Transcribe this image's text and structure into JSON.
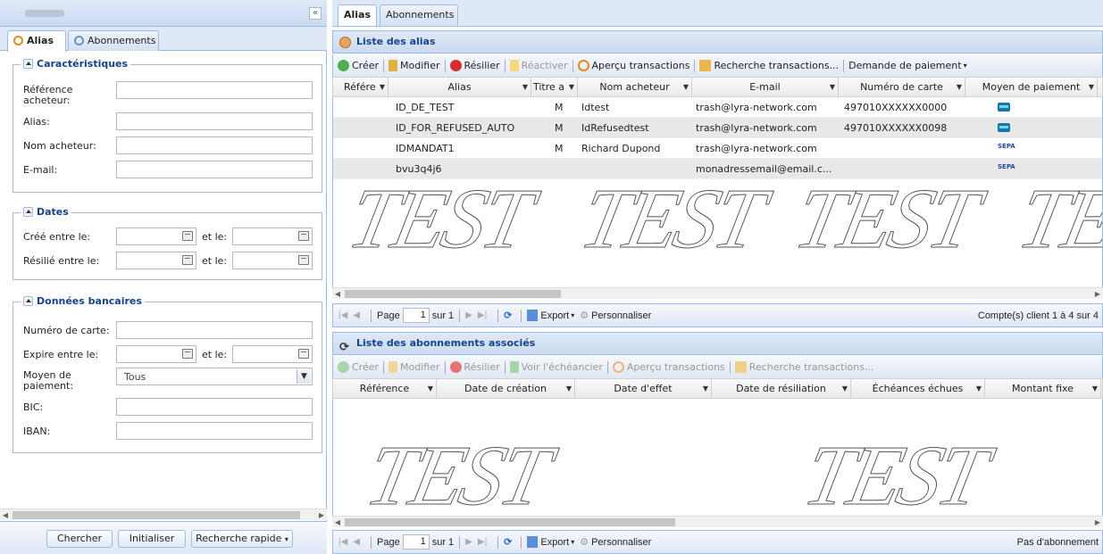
{
  "left_panel": {
    "collapse_glyph": "«",
    "tabs": [
      {
        "label": "Alias"
      },
      {
        "label": "Abonnements"
      }
    ],
    "sections": {
      "caracteristiques": {
        "title": "Caractéristiques",
        "fields": {
          "reference": {
            "label": "Référence acheteur:",
            "value": ""
          },
          "alias": {
            "label": "Alias:",
            "value": ""
          },
          "nom": {
            "label": "Nom acheteur:",
            "value": ""
          },
          "email": {
            "label": "E-mail:",
            "value": ""
          }
        }
      },
      "dates": {
        "title": "Dates",
        "cree": {
          "label": "Créé entre le:",
          "and_label": "et le:"
        },
        "resilie": {
          "label": "Résilié entre le:",
          "and_label": "et le:"
        }
      },
      "bancaires": {
        "title": "Données bancaires",
        "numero": {
          "label": "Numéro de carte:",
          "value": ""
        },
        "expire": {
          "label": "Expire entre le:",
          "and_label": "et le:"
        },
        "moyen": {
          "label": "Moyen de paiement:",
          "value": "Tous"
        },
        "bic": {
          "label": "BIC:",
          "value": ""
        },
        "iban": {
          "label": "IBAN:",
          "value": ""
        }
      }
    },
    "buttons": {
      "search": "Chercher",
      "reset": "Initialiser",
      "quick": "Recherche rapide"
    }
  },
  "right_panel": {
    "tabs": [
      {
        "label": "Alias"
      },
      {
        "label": "Abonnements"
      }
    ],
    "alias_list": {
      "title": "Liste des alias",
      "toolbar": [
        "Créer",
        "Modifier",
        "Résilier",
        "Réactiver",
        "Aperçu transactions",
        "Recherche transactions...",
        "Demande de paiement"
      ],
      "columns": [
        "Référe",
        "Alias",
        "Titre a",
        "Nom acheteur",
        "E-mail",
        "Numéro de carte",
        "Moyen de paiement"
      ],
      "rows": [
        {
          "ref": "",
          "alias": "ID_DE_TEST",
          "titre": "M",
          "nom": "Idtest",
          "email": "trash@lyra-network.com",
          "carte": "497010XXXXXX0000",
          "moyen": "CB"
        },
        {
          "ref": "",
          "alias": "ID_FOR_REFUSED_AUTO",
          "titre": "M",
          "nom": "IdRefusedtest",
          "email": "trash@lyra-network.com",
          "carte": "497010XXXXXX0098",
          "moyen": "CB"
        },
        {
          "ref": "",
          "alias": "IDMANDAT1",
          "titre": "M",
          "nom": "Richard Dupond",
          "email": "trash@lyra-network.com",
          "carte": "",
          "moyen": "SEPA"
        },
        {
          "ref": "",
          "alias": "bvu3q4j6",
          "titre": "",
          "nom": "",
          "email": "monadressemail@email.c...",
          "carte": "",
          "moyen": "SEPA"
        }
      ],
      "pager": {
        "page_label": "Page",
        "page": "1",
        "of": "sur 1",
        "export": "Export",
        "customize": "Personnaliser",
        "status": "Compte(s) client 1 à 4 sur 4"
      }
    },
    "subs_list": {
      "title": "Liste des abonnements associés",
      "toolbar": [
        "Créer",
        "Modifier",
        "Résilier",
        "Voir l'échéancier",
        "Aperçu transactions",
        "Recherche transactions..."
      ],
      "columns": [
        "Référence",
        "Date de création",
        "Date d'effet",
        "Date de résiliation",
        "Échéances échues",
        "Montant fixe"
      ],
      "pager": {
        "page_label": "Page",
        "page": "1",
        "of": "sur 1",
        "export": "Export",
        "customize": "Personnaliser",
        "status": "Pas d'abonnement"
      }
    },
    "watermark": "TEST"
  }
}
